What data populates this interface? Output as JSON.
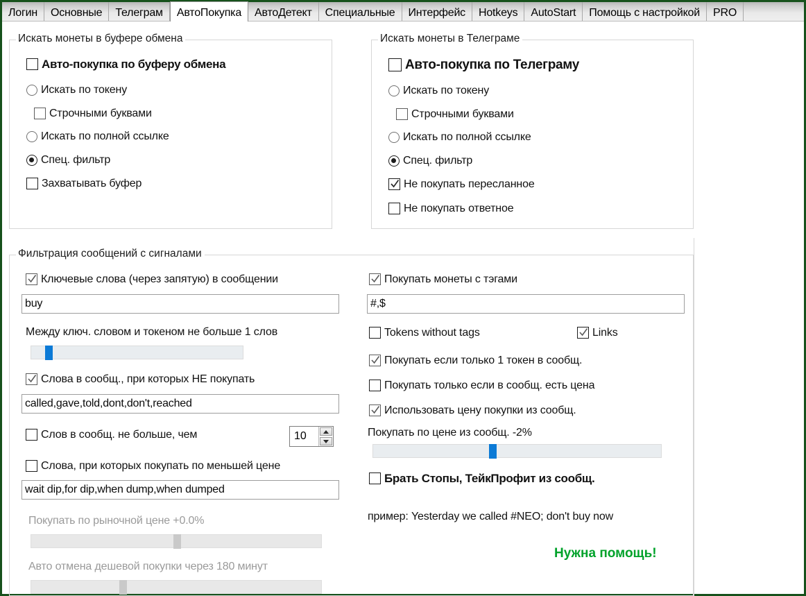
{
  "window": {
    "border_color": "#16511b"
  },
  "tabs": {
    "items": [
      {
        "label": "Логин",
        "active": false
      },
      {
        "label": "Основные",
        "active": false
      },
      {
        "label": "Телеграм",
        "active": false
      },
      {
        "label": "АвтоПокупка",
        "active": true
      },
      {
        "label": "АвтоДетект",
        "active": false
      },
      {
        "label": "Специальные",
        "active": false
      },
      {
        "label": "Интерфейс",
        "active": false
      },
      {
        "label": "Hotkeys",
        "active": false
      },
      {
        "label": "AutoStart",
        "active": false
      },
      {
        "label": "Помощь с настройкой",
        "active": false
      },
      {
        "label": "PRO",
        "active": false
      }
    ]
  },
  "clipboard_group": {
    "title": "Искать монеты в буфере обмена",
    "auto_buy": {
      "label": "Авто-покупка по буферу обмена",
      "checked": false
    },
    "by_token": {
      "label": "Искать по токену",
      "selected": false
    },
    "lowercase": {
      "label": "Строчными буквами",
      "checked": false
    },
    "by_full_link": {
      "label": "Искать по полной ссылке",
      "selected": false
    },
    "special_filter": {
      "label": "Спец. фильтр",
      "selected": true
    },
    "capture_buffer": {
      "label": "Захватывать буфер",
      "checked": false
    }
  },
  "telegram_group": {
    "title": "Искать монеты в Телеграме",
    "auto_buy": {
      "label": "Авто-покупка по Телеграму",
      "checked": false
    },
    "by_token": {
      "label": "Искать по токену",
      "selected": false
    },
    "lowercase": {
      "label": "Строчными буквами",
      "checked": false
    },
    "by_full_link": {
      "label": "Искать по полной ссылке",
      "selected": false
    },
    "special_filter": {
      "label": "Спец. фильтр",
      "selected": true
    },
    "no_forwarded": {
      "label": "Не покупать пересланное",
      "checked": true
    },
    "no_reply": {
      "label": "Не покупать ответное",
      "checked": false
    }
  },
  "filter_group": {
    "title": "Фильтрация сообщений с сигналами",
    "left": {
      "keywords": {
        "label": "Ключевые слова (через запятую) в сообщении",
        "checked": true
      },
      "keywords_value": "buy",
      "gap_label": "Между ключ. словом и токеном не больше 1 слов",
      "gap_slider": {
        "value": 1,
        "min": 0,
        "max": 20,
        "percent": 7
      },
      "stopwords": {
        "label": "Слова в сообщ., при которых НЕ покупать",
        "checked": true
      },
      "stopwords_value": "called,gave,told,dont,don't,reached",
      "max_words": {
        "label": "Слов в сообщ. не больше, чем",
        "checked": false,
        "value": "10"
      },
      "cheaper_words": {
        "label": "Слова, при которых покупать по меньшей цене",
        "checked": false
      },
      "cheaper_words_value": "wait dip,for dip,when dump,when dumped",
      "market_price_label": "Покупать по рыночной цене +0.0%",
      "market_price_slider": {
        "percent": 50,
        "disabled": true
      },
      "auto_cancel_label": "Авто отмена дешевой покупки через 180 минут",
      "auto_cancel_slider": {
        "percent": 30,
        "disabled": true
      }
    },
    "right": {
      "buy_with_tags": {
        "label": "Покупать монеты с тэгами",
        "checked": true
      },
      "tags_value": "#,$",
      "tokens_without_tags": {
        "label": "Tokens without tags",
        "checked": false
      },
      "links": {
        "label": "Links",
        "checked": true
      },
      "only_one_token": {
        "label": "Покупать если только 1 токен в сообщ.",
        "checked": true
      },
      "only_if_price": {
        "label": "Покупать только если в сообщ. есть цена",
        "checked": false
      },
      "use_msg_price": {
        "label": "Использовать цену покупки из сообщ.",
        "checked": true
      },
      "msg_price_label": "Покупать по цене из сообщ. -2%",
      "msg_price_slider": {
        "value": -2,
        "percent": 40
      },
      "take_stops": {
        "label": "Брать Стопы, ТейкПрофит из сообщ.",
        "checked": false
      },
      "example": "пример: Yesterday we called #NEO; don't buy now",
      "help_link": "Нужна помощь!",
      "help_link_color": "#00a22a"
    }
  }
}
